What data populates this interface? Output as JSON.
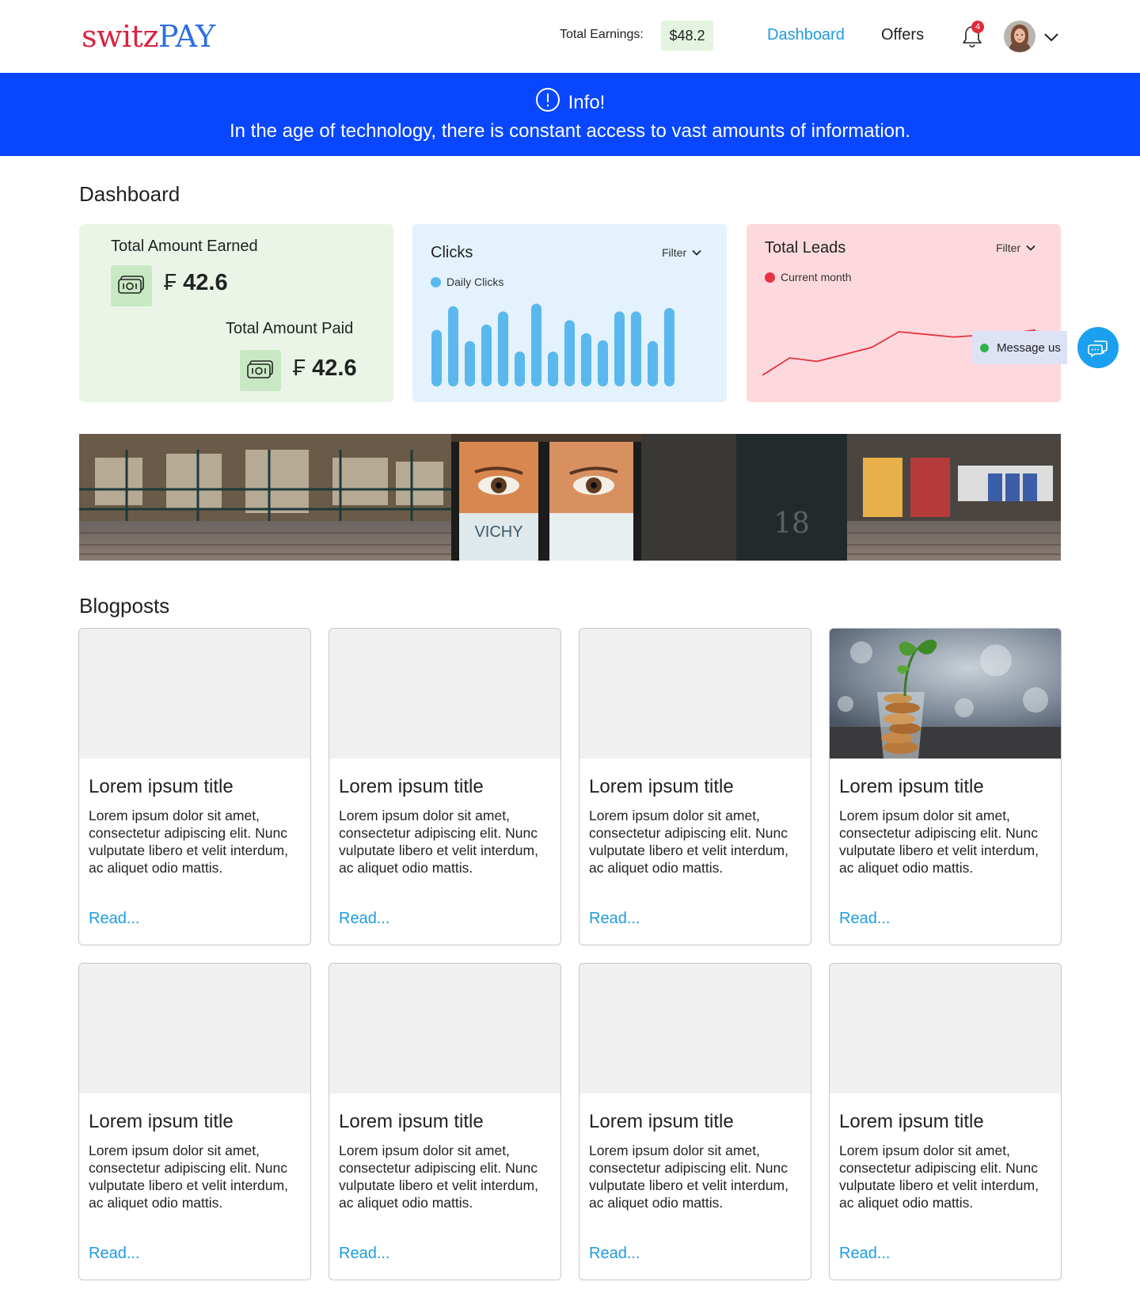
{
  "header": {
    "logo_part1": "switz",
    "logo_part2": "PAY",
    "earnings_label": "Total Earnings:",
    "earnings_value": "$48.2",
    "nav": {
      "dashboard": "Dashboard",
      "offers": "Offers"
    },
    "notification_count": "4",
    "icons": {
      "bell": "bell-icon",
      "avatar": "user-avatar",
      "caret": "chevron-down-icon"
    }
  },
  "info": {
    "title": "Info!",
    "text": "In the age of technology, there is constant access to vast amounts of information.",
    "icon": "info-circle-icon",
    "bg_color": "#0847ff"
  },
  "dashboard": {
    "title": "Dashboard",
    "earned": {
      "label": "Total Amount Earned",
      "currency": "₣",
      "value": "42.6"
    },
    "paid": {
      "label": "Total Amount Paid",
      "currency": "₣",
      "value": "42.6"
    },
    "clicks": {
      "title": "Clicks",
      "filter": "Filter",
      "legend": "Daily Clicks",
      "color": "#5ab8ef"
    },
    "leads": {
      "title": "Total Leads",
      "filter": "Filter",
      "legend": "Current month",
      "color": "#e8323f"
    }
  },
  "chart_data": [
    {
      "type": "bar",
      "title": "Clicks",
      "series": [
        {
          "name": "Daily Clicks",
          "values": [
            65,
            92,
            52,
            71,
            86,
            40,
            95,
            40,
            76,
            61,
            53,
            86,
            86,
            52,
            90
          ]
        }
      ],
      "ylim": [
        0,
        100
      ]
    },
    {
      "type": "line",
      "title": "Total Leads",
      "series": [
        {
          "name": "Current month",
          "values": [
            10,
            30,
            26,
            34,
            42,
            60,
            57,
            54,
            56,
            58,
            62
          ]
        }
      ],
      "ylim": [
        0,
        100
      ]
    }
  ],
  "chat": {
    "label": "Message us",
    "status_color": "#2fb24a",
    "icon": "chat-icon"
  },
  "blog": {
    "title": "Blogposts",
    "posts": [
      {
        "title": "Lorem ipsum title",
        "body": "Lorem ipsum dolor sit amet, consectetur adipiscing elit. Nunc vulputate libero et velit interdum, ac aliquet odio mattis.",
        "link": "Read..."
      },
      {
        "title": "Lorem ipsum title",
        "body": "Lorem ipsum dolor sit amet, consectetur adipiscing elit. Nunc vulputate libero et velit interdum, ac aliquet odio mattis.",
        "link": "Read..."
      },
      {
        "title": "Lorem ipsum title",
        "body": "Lorem ipsum dolor sit amet, consectetur adipiscing elit. Nunc vulputate libero et velit interdum, ac aliquet odio mattis.",
        "link": "Read..."
      },
      {
        "title": "Lorem ipsum title",
        "body": "Lorem ipsum dolor sit amet, consectetur adipiscing elit. Nunc vulputate libero et velit interdum, ac aliquet odio mattis.",
        "link": "Read..."
      },
      {
        "title": "Lorem ipsum title",
        "body": "Lorem ipsum dolor sit amet, consectetur adipiscing elit. Nunc vulputate libero et velit interdum, ac aliquet odio mattis.",
        "link": "Read..."
      },
      {
        "title": "Lorem ipsum title",
        "body": "Lorem ipsum dolor sit amet, consectetur adipiscing elit. Nunc vulputate libero et velit interdum, ac aliquet odio mattis.",
        "link": "Read..."
      },
      {
        "title": "Lorem ipsum title",
        "body": "Lorem ipsum dolor sit amet, consectetur adipiscing elit. Nunc vulputate libero et velit interdum, ac aliquet odio mattis.",
        "link": "Read..."
      },
      {
        "title": "Lorem ipsum title",
        "body": "Lorem ipsum dolor sit amet, consectetur adipiscing elit. Nunc vulputate libero et velit interdum, ac aliquet odio mattis.",
        "link": "Read..."
      }
    ]
  },
  "banner": {
    "sign_text": "VICHY",
    "platform_number": "18"
  }
}
